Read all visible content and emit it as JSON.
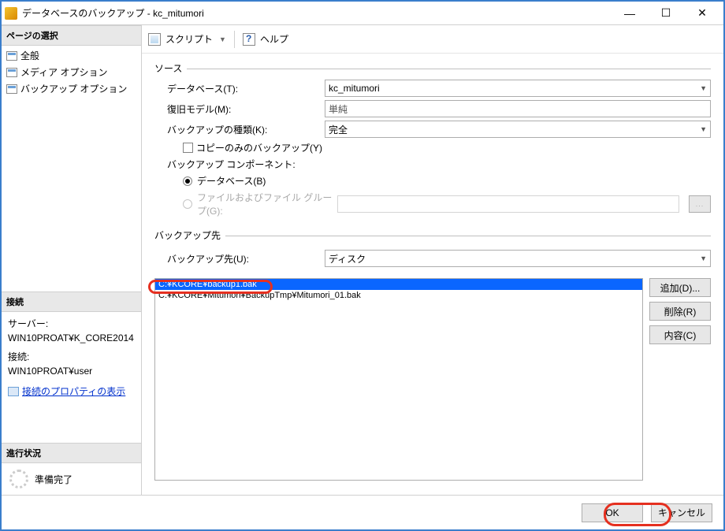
{
  "title": "データベースのバックアップ - kc_mitumori",
  "winbtns": {
    "min": "—",
    "max": "☐",
    "close": "✕"
  },
  "sidebar": {
    "hdr_pages": "ページの選択",
    "items": [
      "全般",
      "メディア オプション",
      "バックアップ オプション"
    ],
    "hdr_conn": "接続",
    "server_lbl": "サーバー:",
    "server_val": "WIN10PROAT¥K_CORE2014",
    "conn_lbl": "接続:",
    "conn_val": "WIN10PROAT¥user",
    "link": "接続のプロパティの表示",
    "hdr_progress": "進行状況",
    "progress": "準備完了"
  },
  "toolbar": {
    "script": "スクリプト",
    "help": "ヘルプ"
  },
  "source": {
    "group": "ソース",
    "db_lbl": "データベース(T):",
    "db_val": "kc_mitumori",
    "recovery_lbl": "復旧モデル(M):",
    "recovery_val": "単純",
    "type_lbl": "バックアップの種類(K):",
    "type_val": "完全",
    "copyonly": "コピーのみのバックアップ(Y)",
    "component_lbl": "バックアップ コンポーネント:",
    "radio_db": "データベース(B)",
    "radio_fg": "ファイルおよびファイル グループ(G):",
    "browse": "..."
  },
  "dest": {
    "group": "バックアップ先",
    "to_lbl": "バックアップ先(U):",
    "to_val": "ディスク",
    "items": [
      "C:¥KCORE¥backup1.bak",
      "C:¥KCORE¥Mitumori¥BackupTmp¥Mitumori_01.bak"
    ],
    "add": "追加(D)...",
    "remove": "削除(R)",
    "contents": "内容(C)"
  },
  "footer": {
    "ok": "OK",
    "cancel": "キャンセル"
  }
}
